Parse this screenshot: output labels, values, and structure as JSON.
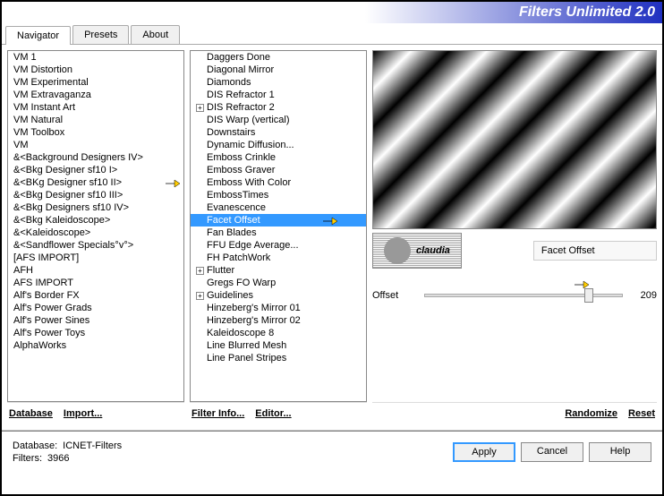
{
  "header": {
    "title": "Filters Unlimited 2.0"
  },
  "tabs": [
    {
      "label": "Navigator",
      "active": true
    },
    {
      "label": "Presets",
      "active": false
    },
    {
      "label": "About",
      "active": false
    }
  ],
  "categories": [
    "VM 1",
    "VM Distortion",
    "VM Experimental",
    "VM Extravaganza",
    "VM Instant Art",
    "VM Natural",
    "VM Toolbox",
    "VM",
    "&<Background Designers IV>",
    "&<Bkg Designer sf10 I>",
    "&<BKg Designer sf10 II>",
    "&<Bkg Designer sf10 III>",
    "&<Bkg Designers sf10 IV>",
    "&<Bkg Kaleidoscope>",
    "&<Kaleidoscope>",
    "&<Sandflower Specials°v°>",
    "[AFS IMPORT]",
    "AFH",
    "AFS IMPORT",
    "Alf's Border FX",
    "Alf's Power Grads",
    "Alf's Power Sines",
    "Alf's Power Toys",
    "AlphaWorks"
  ],
  "categories_highlight_index": 10,
  "filters": [
    {
      "label": "Daggers Done",
      "tree": false
    },
    {
      "label": "Diagonal Mirror",
      "tree": false
    },
    {
      "label": "Diamonds",
      "tree": false
    },
    {
      "label": "DIS Refractor 1",
      "tree": false
    },
    {
      "label": "DIS Refractor 2",
      "tree": true
    },
    {
      "label": "DIS Warp (vertical)",
      "tree": false
    },
    {
      "label": "Downstairs",
      "tree": false
    },
    {
      "label": "Dynamic Diffusion...",
      "tree": false
    },
    {
      "label": "Emboss Crinkle",
      "tree": false
    },
    {
      "label": "Emboss Graver",
      "tree": false
    },
    {
      "label": "Emboss With Color",
      "tree": false
    },
    {
      "label": "EmbossTimes",
      "tree": false
    },
    {
      "label": "Evanescence",
      "tree": false
    },
    {
      "label": "Facet Offset",
      "tree": false
    },
    {
      "label": "Fan Blades",
      "tree": false
    },
    {
      "label": "FFU Edge Average...",
      "tree": false
    },
    {
      "label": "FH PatchWork",
      "tree": false
    },
    {
      "label": "Flutter",
      "tree": true
    },
    {
      "label": "Gregs FO Warp",
      "tree": false
    },
    {
      "label": "Guidelines",
      "tree": true
    },
    {
      "label": "Hinzeberg's Mirror 01",
      "tree": false
    },
    {
      "label": "Hinzeberg's Mirror 02",
      "tree": false
    },
    {
      "label": "Kaleidoscope 8",
      "tree": false
    },
    {
      "label": "Line Blurred Mesh",
      "tree": false
    },
    {
      "label": "Line Panel Stripes",
      "tree": false
    }
  ],
  "filters_selected_index": 13,
  "links": {
    "database": "Database",
    "import": "Import...",
    "filterinfo": "Filter Info...",
    "editor": "Editor...",
    "randomize": "Randomize",
    "reset": "Reset"
  },
  "selected_filter": "Facet Offset",
  "watermark": "claudia",
  "param": {
    "label": "Offset",
    "value": "209"
  },
  "status": {
    "db_label": "Database:",
    "db_value": "ICNET-Filters",
    "filters_label": "Filters:",
    "filters_value": "3966"
  },
  "buttons": {
    "apply": "Apply",
    "cancel": "Cancel",
    "help": "Help"
  }
}
